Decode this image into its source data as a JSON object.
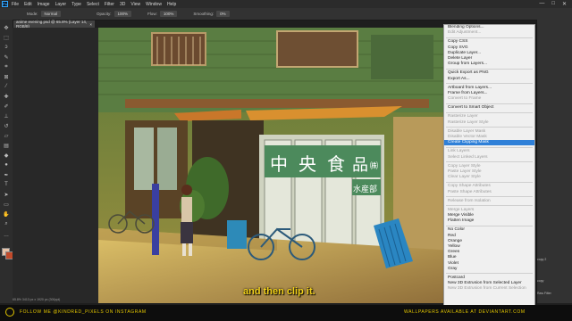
{
  "menubar": {
    "app_icon": "Ps",
    "items": [
      "File",
      "Edit",
      "Image",
      "Layer",
      "Type",
      "Select",
      "Filter",
      "3D",
      "View",
      "Window",
      "Help"
    ],
    "window_controls": [
      "—",
      "□",
      "✕"
    ]
  },
  "options_bar": {
    "mode_label": "Mode:",
    "mode_value": "Normal",
    "opacity_label": "Opacity:",
    "opacity_value": "100%",
    "flow_label": "Flow:",
    "flow_value": "100%",
    "smoothing_label": "Smoothing:",
    "smoothing_value": "0%"
  },
  "document_tab": {
    "title": "anime evening.psd @ 65.8% (Layer 14, RGB/8)",
    "close_glyph": "×"
  },
  "tools": [
    "move-icon",
    "marquee-icon",
    "lasso-icon",
    "quick-select-icon",
    "crop-icon",
    "frame-icon",
    "eyedropper-icon",
    "healing-icon",
    "brush-icon",
    "stamp-icon",
    "history-brush-icon",
    "eraser-icon",
    "gradient-icon",
    "blur-icon",
    "dodge-icon",
    "pen-icon",
    "type-icon",
    "path-select-icon",
    "shape-icon",
    "hand-icon",
    "zoom-icon"
  ],
  "colors": {
    "foreground": "#e8c3a8",
    "background": "#c24a2a",
    "menu_highlight": "#2f80d8",
    "caption": "#f3d21a"
  },
  "context_menu": {
    "groups": [
      [
        {
          "label": "Blending Options...",
          "enabled": true
        },
        {
          "label": "Edit Adjustment...",
          "enabled": false
        }
      ],
      [
        {
          "label": "Copy CSS",
          "enabled": true
        },
        {
          "label": "Copy SVG",
          "enabled": true
        },
        {
          "label": "Duplicate Layer...",
          "enabled": true
        },
        {
          "label": "Delete Layer",
          "enabled": true
        },
        {
          "label": "Group from Layers...",
          "enabled": true
        }
      ],
      [
        {
          "label": "Quick Export as PNG",
          "enabled": true
        },
        {
          "label": "Export As...",
          "enabled": true
        }
      ],
      [
        {
          "label": "Artboard from Layers...",
          "enabled": true
        },
        {
          "label": "Frame from Layers...",
          "enabled": true
        },
        {
          "label": "Convert to Frame",
          "enabled": false
        }
      ],
      [
        {
          "label": "Convert to Smart Object",
          "enabled": true
        }
      ],
      [
        {
          "label": "Rasterize Layer",
          "enabled": false
        },
        {
          "label": "Rasterize Layer Style",
          "enabled": false
        }
      ],
      [
        {
          "label": "Disable Layer Mask",
          "enabled": false
        },
        {
          "label": "Disable Vector Mask",
          "enabled": false
        },
        {
          "label": "Create Clipping Mask",
          "enabled": true,
          "highlight": true
        }
      ],
      [
        {
          "label": "Link Layers",
          "enabled": false
        },
        {
          "label": "Select Linked Layers",
          "enabled": false
        }
      ],
      [
        {
          "label": "Copy Layer Style",
          "enabled": false
        },
        {
          "label": "Paste Layer Style",
          "enabled": false
        },
        {
          "label": "Clear Layer Style",
          "enabled": false
        }
      ],
      [
        {
          "label": "Copy Shape Attributes",
          "enabled": false
        },
        {
          "label": "Paste Shape Attributes",
          "enabled": false
        }
      ],
      [
        {
          "label": "Release from Isolation",
          "enabled": false
        }
      ],
      [
        {
          "label": "Merge Layers",
          "enabled": false
        },
        {
          "label": "Merge Visible",
          "enabled": true
        },
        {
          "label": "Flatten Image",
          "enabled": true
        }
      ],
      [
        {
          "label": "No Color",
          "enabled": true
        },
        {
          "label": "Red",
          "enabled": true
        },
        {
          "label": "Orange",
          "enabled": true
        },
        {
          "label": "Yellow",
          "enabled": true
        },
        {
          "label": "Green",
          "enabled": true
        },
        {
          "label": "Blue",
          "enabled": true
        },
        {
          "label": "Violet",
          "enabled": true
        },
        {
          "label": "Gray",
          "enabled": true
        }
      ],
      [
        {
          "label": "Postcard",
          "enabled": true
        },
        {
          "label": "New 3D Extrusion from Selected Layer",
          "enabled": true
        },
        {
          "label": "New 3D Extrusion from Current Selection",
          "enabled": false
        }
      ]
    ]
  },
  "photo": {
    "sign_chars": [
      "中",
      "央",
      "食",
      "品",
      "㈱"
    ],
    "sign_sub": "水産部"
  },
  "layers_panel": {
    "rows": [
      "copy 2",
      "copy",
      "Raw Filter"
    ]
  },
  "status_bar": {
    "zoom": "65.8%",
    "doc_info": "3413 px x 1920 px (300ppi)"
  },
  "caption": "and then clip it.",
  "footer": {
    "left_text": "FOLLOW ME @KINDRED_PIXELS ON INSTAGRAM",
    "right_text": "WALLPAPERS AVAILABLE AT DEVIANTART.COM"
  }
}
